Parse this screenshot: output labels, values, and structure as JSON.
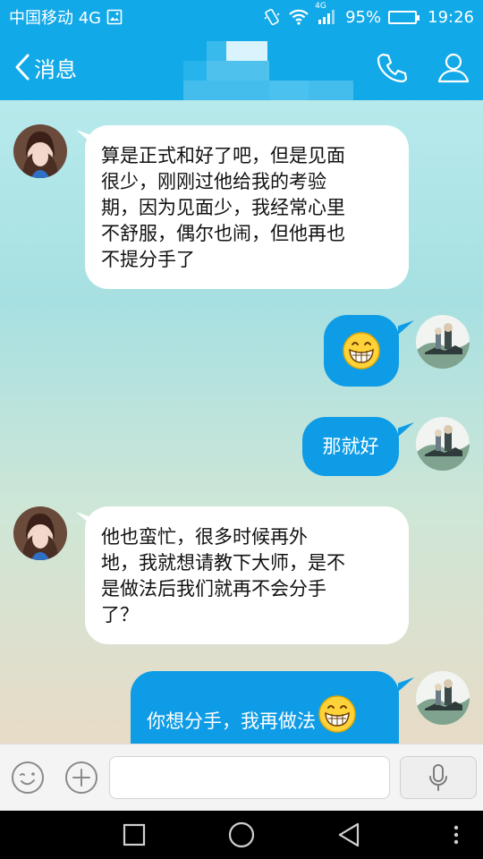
{
  "status_bar": {
    "carrier": "中国移动 4G",
    "network_tag": "4G",
    "battery_percent": "95%",
    "battery_level": 0.95,
    "time": "19:26"
  },
  "header": {
    "back_label": "消息",
    "contact_name_obscured": true
  },
  "messages": [
    {
      "side": "in",
      "text_lines": [
        "算是正式和好了吧，但是见面",
        "很少，刚刚过他给我的考验",
        "期，因为见面少，我经常心里",
        "不舒服，偶尔也闹，但他再也",
        "不提分手了"
      ]
    },
    {
      "side": "out",
      "emoji": "grin-emoji"
    },
    {
      "side": "out",
      "text": "那就好"
    },
    {
      "side": "in",
      "text_lines": [
        "他也蛮忙，很多时候再外",
        "地，我就想请教下大师，是不",
        "是做法后我们就再不会分手",
        "了？"
      ]
    },
    {
      "side": "out",
      "text": "你想分手，我再做法",
      "emoji": "grin-emoji"
    }
  ],
  "input_bar": {
    "text_value": "",
    "icons": [
      "emoji-icon",
      "plus-icon",
      "microphone-icon"
    ]
  },
  "nav_bar": {
    "icons": [
      "recent-apps-icon",
      "home-icon",
      "back-icon",
      "more-icon"
    ]
  },
  "colors": {
    "accent": "#12a9e8",
    "bubble_out": "#0f9ce6",
    "bubble_in": "#ffffff"
  }
}
